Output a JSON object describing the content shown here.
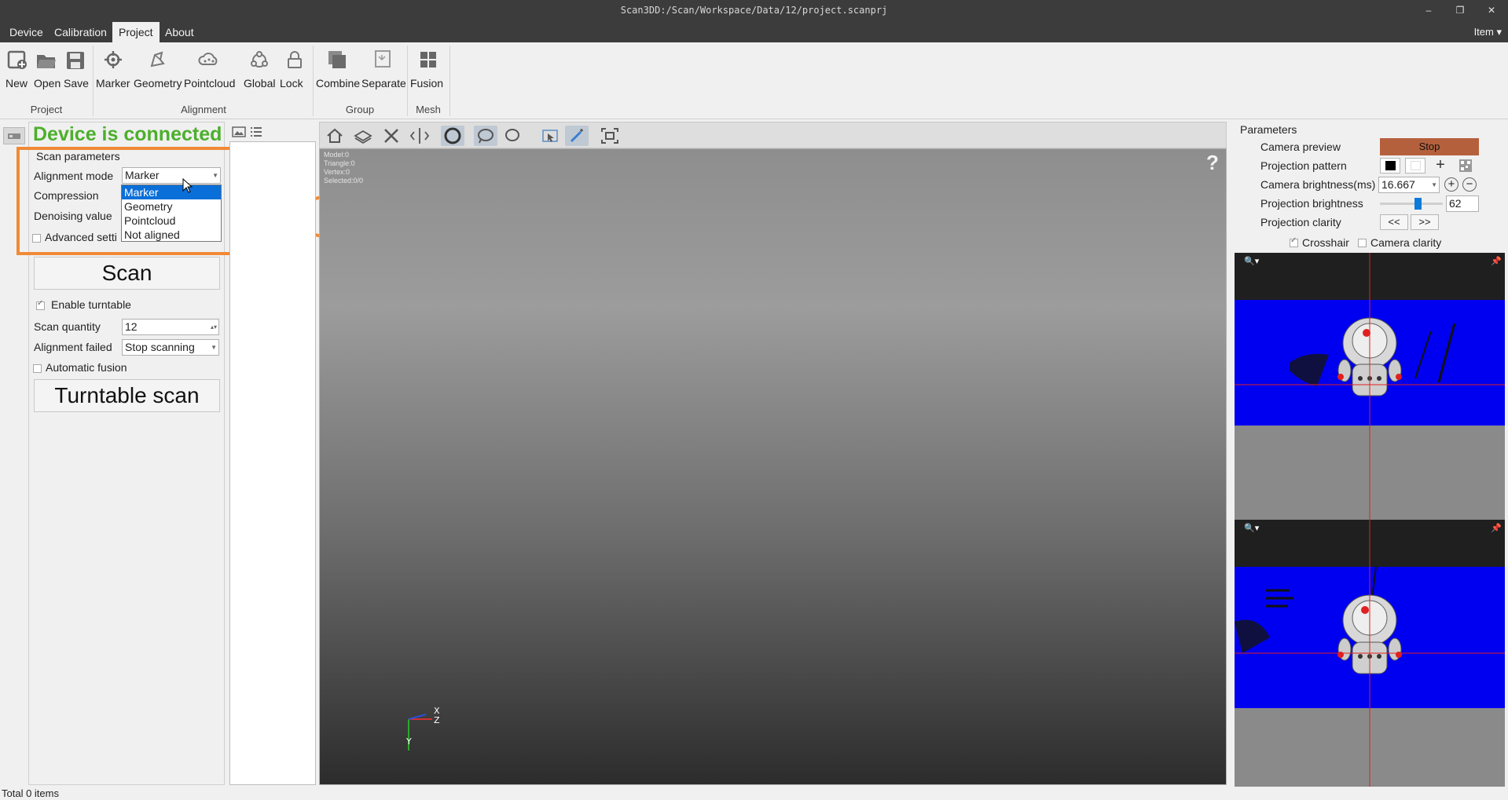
{
  "window": {
    "title": "Scan3DD:/Scan/Workspace/Data/12/project.scanprj",
    "controls": [
      "minimize-icon",
      "restore-icon",
      "close-icon"
    ]
  },
  "menu": {
    "items": [
      "Device",
      "Calibration",
      "Project",
      "About"
    ],
    "active": "Project",
    "right_item": "Item"
  },
  "ribbon": {
    "buttons": {
      "new": "New",
      "open": "Open",
      "save": "Save",
      "marker": "Marker",
      "geometry": "Geometry",
      "pointcloud": "Pointcloud",
      "global": "Global",
      "lock": "Lock",
      "combine": "Combine",
      "separate": "Separate",
      "fusion": "Fusion"
    },
    "groups": {
      "project": "Project",
      "alignment": "Alignment",
      "group": "Group",
      "mesh": "Mesh"
    }
  },
  "left_panel": {
    "status": "Device is connected",
    "status_color": "#4caf2c",
    "section_title": "Scan parameters",
    "alignment_mode_label": "Alignment mode",
    "alignment_mode_value": "Marker",
    "alignment_options": [
      "Marker",
      "Geometry",
      "Pointcloud",
      "Not aligned"
    ],
    "compression_label": "Compression",
    "denoising_label": "Denoising value",
    "advanced_label": "Advanced setti",
    "scan_button": "Scan",
    "enable_turntable": {
      "label": "Enable turntable",
      "checked": true
    },
    "scan_quantity_label": "Scan quantity",
    "scan_quantity_value": "12",
    "alignment_failed_label": "Alignment failed",
    "alignment_failed_value": "Stop scanning",
    "automatic_fusion": {
      "label": "Automatic fusion",
      "checked": false
    },
    "turntable_scan_button": "Turntable scan"
  },
  "viewport": {
    "stats": [
      "Model:0",
      "Triangle:0",
      "Vertex:0",
      "Selected:0/0"
    ],
    "help": "?",
    "axes": {
      "x": "X",
      "y": "Y",
      "z": "Z"
    }
  },
  "right_panel": {
    "title": "Parameters",
    "camera_preview_label": "Camera preview",
    "stop_button": "Stop",
    "stop_color": "#b5603c",
    "projection_pattern_label": "Projection pattern",
    "camera_brightness_label": "Camera brightness(ms)",
    "camera_brightness_value": "16.667",
    "projection_brightness_label": "Projection brightness",
    "projection_brightness_value": "62",
    "projection_clarity_label": "Projection clarity",
    "clarity_prev": "<<",
    "clarity_next": ">>",
    "crosshair": {
      "label": "Crosshair",
      "checked": true
    },
    "camera_clarity": {
      "label": "Camera clarity",
      "checked": false
    }
  },
  "annotation": {
    "arrow_color": "#f08a36"
  },
  "status_bar": {
    "text": "Total 0 items"
  }
}
